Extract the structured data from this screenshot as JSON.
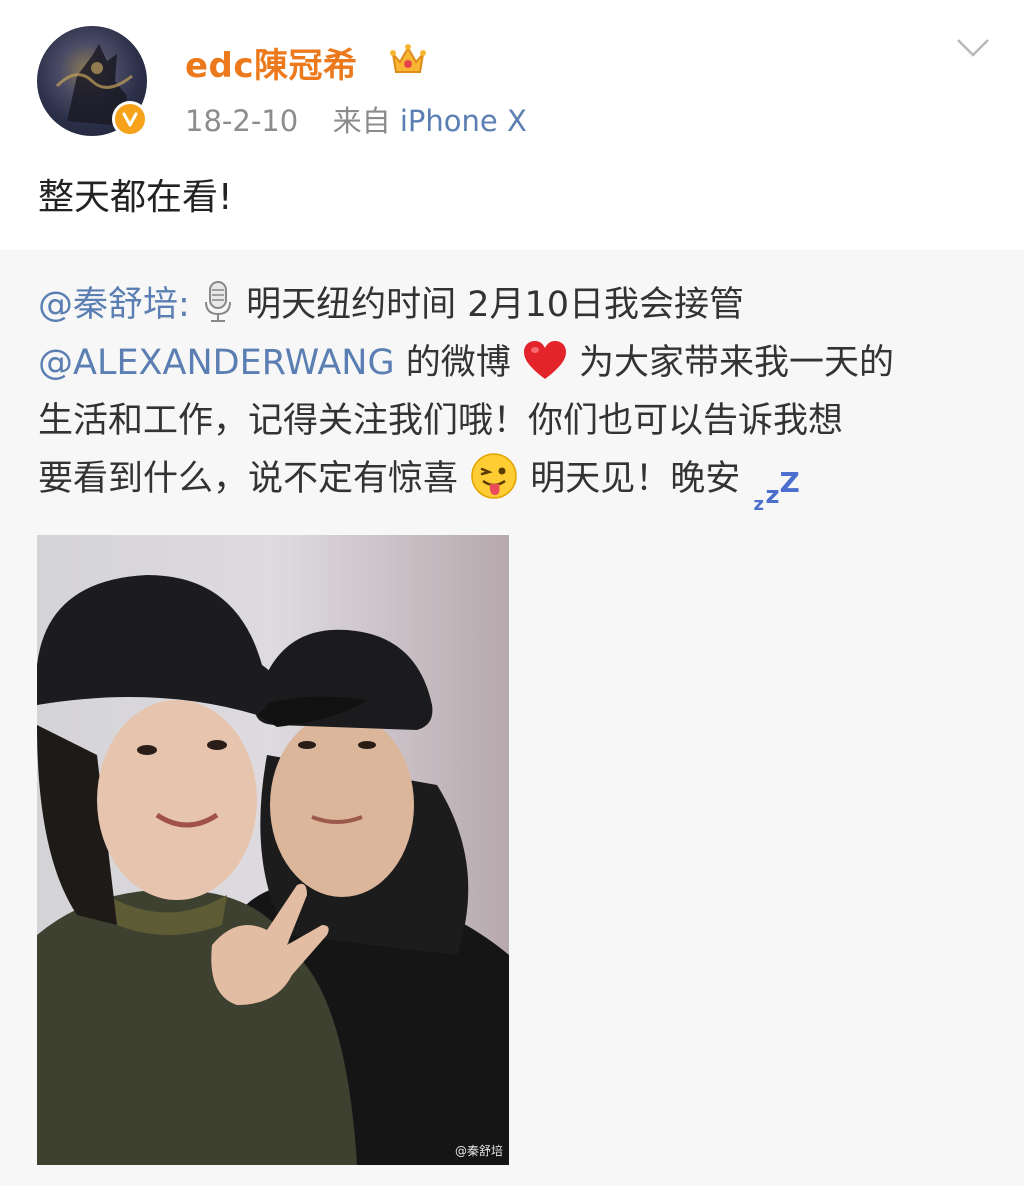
{
  "post": {
    "author": "edc陳冠希",
    "date": "18-2-10",
    "from_label": "来自",
    "source": "iPhone X",
    "text": "整天都在看!"
  },
  "repost": {
    "mention1": "@秦舒培:",
    "line1_rest": "明天纽约时间 2月10日我会接管",
    "mention2": "@ALEXANDERWANG",
    "line2_mid": "的微博",
    "line2_rest": "为大家带来我一天的",
    "line3": "生活和工作，记得关注我们哦！你们也可以告诉我想",
    "line4_a": "要看到什么，说不定有惊喜",
    "line4_b": "明天见！晚安",
    "zzz": [
      "z",
      "z",
      "Z"
    ]
  },
  "photo": {
    "watermark": "@秦舒培"
  },
  "icons": {
    "verified_color": "#f6a21b",
    "username_color": "#ec7a1d",
    "link_color": "#5b7fb2"
  }
}
